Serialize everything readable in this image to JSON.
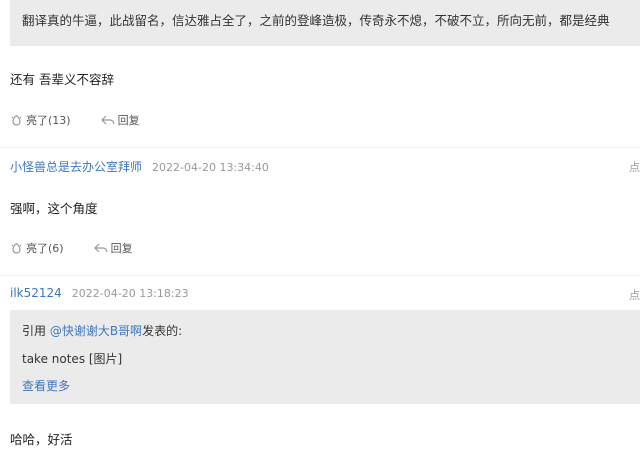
{
  "top_quote": {
    "text": "翻译真的牛逼，此战留名，信达雅占全了，之前的登峰造极，传奇永不熄，不破不立，所向无前，都是经典"
  },
  "post1": {
    "body": "还有 吾辈义不容辞",
    "like_label": "亮了(13)",
    "reply_label": "回复"
  },
  "post2": {
    "username": "小怪兽总是去办公室拜师",
    "timestamp": "2022-04-20 13:34:40",
    "more_label": "点",
    "body": "强啊，这个角度",
    "like_label": "亮了(6)",
    "reply_label": "回复"
  },
  "post3": {
    "username": "ilk52124",
    "timestamp": "2022-04-20 13:18:23",
    "more_label": "点",
    "quote": {
      "prefix": "引用 ",
      "author": "@快谢谢大B哥啊",
      "suffix": "发表的:",
      "body": "take notes [图片]",
      "more": "查看更多"
    },
    "body": "哈哈，好活"
  },
  "icons": {
    "like": "like-icon",
    "reply": "reply-icon"
  },
  "colors": {
    "link": "#3e77c1",
    "quote_bg": "#ebebeb",
    "timestamp": "#999999"
  }
}
